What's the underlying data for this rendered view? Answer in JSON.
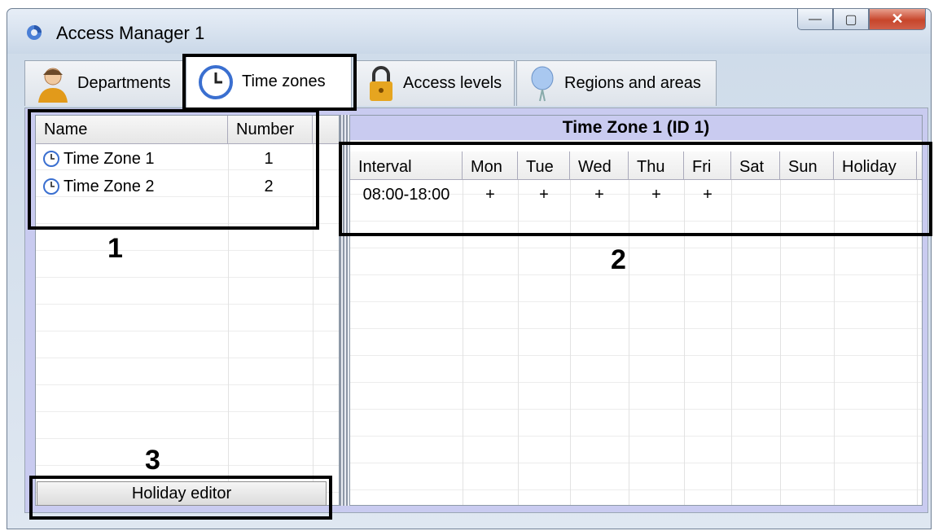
{
  "window": {
    "title": "Access Manager 1",
    "minimize": "—",
    "maximize": "▢",
    "close": "✕"
  },
  "tabs": [
    {
      "label": "Departments",
      "icon": "person-icon"
    },
    {
      "label": "Time zones",
      "icon": "clock-icon",
      "active": true
    },
    {
      "label": "Access levels",
      "icon": "lock-icon"
    },
    {
      "label": "Regions and areas",
      "icon": "balloon-icon"
    }
  ],
  "time_zones_list": {
    "headers": {
      "name": "Name",
      "number": "Number"
    },
    "rows": [
      {
        "name": "Time Zone 1",
        "number": "1"
      },
      {
        "name": "Time Zone 2",
        "number": "2"
      }
    ]
  },
  "schedule": {
    "title": "Time Zone 1 (ID 1)",
    "headers": [
      "Interval",
      "Mon",
      "Tue",
      "Wed",
      "Thu",
      "Fri",
      "Sat",
      "Sun",
      "Holiday"
    ],
    "rows": [
      {
        "cells": [
          "08:00-18:00",
          "+",
          "+",
          "+",
          "+",
          "+",
          "",
          "",
          ""
        ]
      }
    ]
  },
  "holiday_button": "Holiday editor",
  "callouts": [
    "1",
    "2",
    "3"
  ],
  "colors": {
    "content_bg": "#c9cbf0",
    "close_red": "#c7452b",
    "clock_blue": "#3a6fd0"
  }
}
